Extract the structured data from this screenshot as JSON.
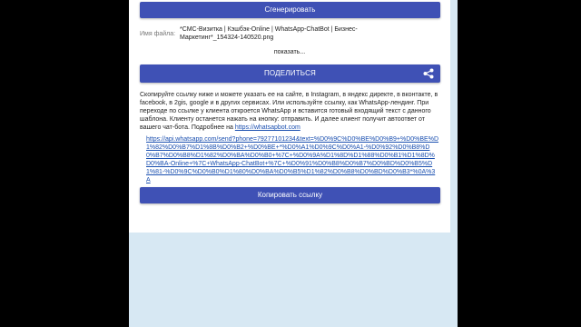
{
  "generate_button": {
    "label": "Сгенерировать"
  },
  "file": {
    "label": "Имя файла:",
    "value": "*СМС-Визитка | Кэшбэк-Online | WhatsApp-ChatBot | Бизнес-Маркетинг*_154324-140520.png"
  },
  "show_link": "показать...",
  "share_button": {
    "label": "ПОДЕЛИТЬСЯ",
    "icon": "share-icon"
  },
  "description": {
    "text": "Скопируйте ссылку ниже и можете указать ее на сайте, в Instagram, в яндекс директе, в вконтакте, в facebook, в 2gis, google и в других сервисах. Или используйте ссылку, как WhatsApp-лендинг. При переходе по ссылке у клиента откроется WhatsApp и вставится готовый входящий текст с данного шаблона. Клиенту останется нажать на кнопку: отправить. И далее клиент получит автоответ от вашего чат-бота. Подробнее на ",
    "link": "https://whatsapbot.com"
  },
  "whatsapp_link": "https://api.whatsapp.com/send?phone=79277101234&text=%D0%9C%D0%BE%D0%B9+%D0%BE%D1%82%D0%B7%D1%8B%D0%B2+%D0%BE+*%D0%A1%D0%9C%D0%A1-%D0%92%D0%B8%D0%B7%D0%B8%D1%82%D0%BA%D0%B0+%7C+%D0%9A%D1%8D%D1%88%D0%B1%D1%8D%D0%BA-Online+%7C+WhatsApp-ChatBot+%7C+%D0%91%D0%B8%D0%B7%D0%BD%D0%B5%D1%81-%D0%9C%D0%B0%D1%80%D0%BA%D0%B5%D1%82%D0%B8%D0%BD%D0%B3*%0A%3A",
  "copy_button": {
    "label": "Копировать ссылку"
  },
  "colors": {
    "primary": "#3f51b5",
    "link": "#1a4fb0",
    "background": "#d7e8f3"
  }
}
